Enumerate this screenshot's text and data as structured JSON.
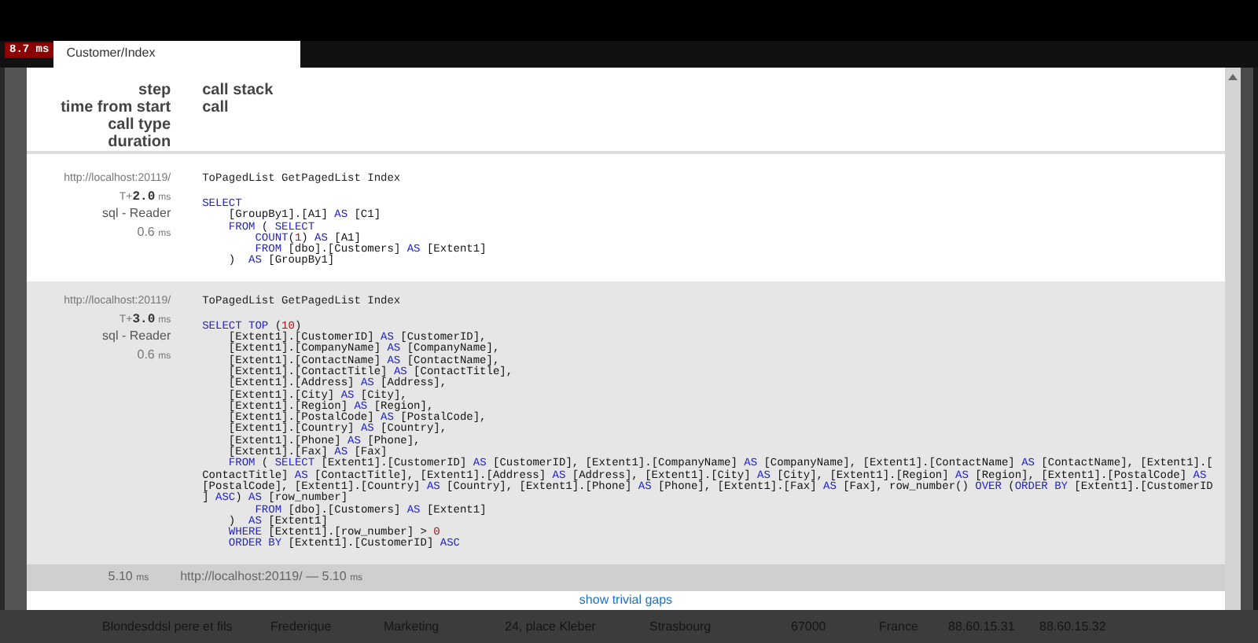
{
  "badge": "8.7 ms",
  "tab": {
    "label": "Customer/Index",
    "selected": true
  },
  "header": {
    "left": [
      "step",
      "time from start",
      "call type",
      "duration"
    ],
    "right": [
      "call stack",
      "call"
    ]
  },
  "timings": [
    {
      "url": "http://localhost:20119/",
      "time_prefix": "T+",
      "time": "2.0",
      "time_unit": "ms",
      "type": "sql - Reader",
      "duration": "0.6",
      "duration_unit": "ms",
      "stack": "ToPagedList GetPagedList Index",
      "sql": [
        "SELECT",
        "    [GroupBy1].[A1] AS [C1]",
        "    FROM ( SELECT",
        "        COUNT(1) AS [A1]",
        "        FROM [dbo].[Customers] AS [Extent1]",
        "    )  AS [GroupBy1]"
      ]
    },
    {
      "url": "http://localhost:20119/",
      "time_prefix": "T+",
      "time": "3.0",
      "time_unit": "ms",
      "type": "sql - Reader",
      "duration": "0.6",
      "duration_unit": "ms",
      "stack": "ToPagedList GetPagedList Index",
      "sql": [
        "SELECT TOP (10)",
        "    [Extent1].[CustomerID] AS [CustomerID],",
        "    [Extent1].[CompanyName] AS [CompanyName],",
        "    [Extent1].[ContactName] AS [ContactName],",
        "    [Extent1].[ContactTitle] AS [ContactTitle],",
        "    [Extent1].[Address] AS [Address],",
        "    [Extent1].[City] AS [City],",
        "    [Extent1].[Region] AS [Region],",
        "    [Extent1].[PostalCode] AS [PostalCode],",
        "    [Extent1].[Country] AS [Country],",
        "    [Extent1].[Phone] AS [Phone],",
        "    [Extent1].[Fax] AS [Fax]",
        "    FROM ( SELECT [Extent1].[CustomerID] AS [CustomerID], [Extent1].[CompanyName] AS [CompanyName], [Extent1].[ContactName] AS [ContactName], [Extent1].[",
        "ContactTitle] AS [ContactTitle], [Extent1].[Address] AS [Address], [Extent1].[City] AS [City], [Extent1].[Region] AS [Region], [Extent1].[PostalCode] AS",
        "[PostalCode], [Extent1].[Country] AS [Country], [Extent1].[Phone] AS [Phone], [Extent1].[Fax] AS [Fax], row_number() OVER (ORDER BY [Extent1].[CustomerID",
        "] ASC) AS [row_number]",
        "        FROM [dbo].[Customers] AS [Extent1]",
        "    )  AS [Extent1]",
        "    WHERE [Extent1].[row_number] > 0",
        "    ORDER BY [Extent1].[CustomerID] ASC"
      ]
    }
  ],
  "total": {
    "duration": "5.10",
    "unit": "ms",
    "url": "http://localhost:20119/ — ",
    "url_duration": "5.10",
    "url_unit": "ms"
  },
  "trivial_link": "show trivial gaps",
  "background_row": [
    "Blondesddsl pere et fils",
    "Frederique",
    "Marketing",
    "24, place Kleber",
    "Strasbourg",
    "67000",
    "France",
    "88.60.15.31",
    "88.60.15.32"
  ]
}
